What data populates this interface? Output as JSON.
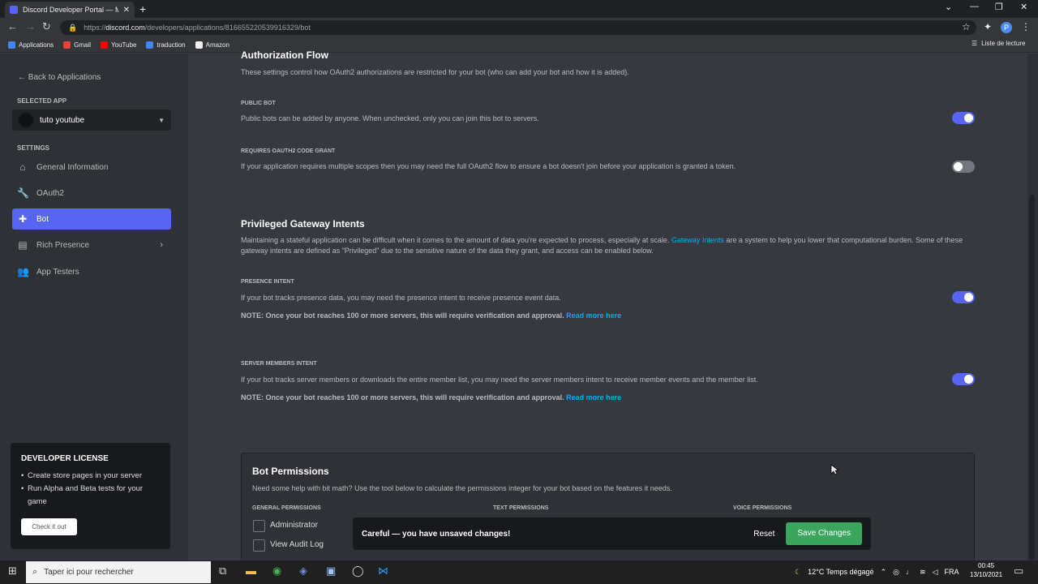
{
  "browser": {
    "tab_title": "Discord Developer Portal — My A",
    "url_prefix": "https://",
    "url_domain": "discord.com",
    "url_path": "/developers/applications/816655220539916329/bot",
    "bookmarks": [
      "Applications",
      "Gmail",
      "YouTube",
      "traduction",
      "Amazon"
    ],
    "reading_list": "Liste de lecture",
    "profile_initial": "P"
  },
  "sidebar": {
    "back": "Back to Applications",
    "selected_app_label": "SELECTED APP",
    "app_name": "tuto youtube",
    "settings_label": "SETTINGS",
    "items": [
      {
        "label": "General Information",
        "icon": "home-icon"
      },
      {
        "label": "OAuth2",
        "icon": "wrench-icon"
      },
      {
        "label": "Bot",
        "icon": "puzzle-icon"
      },
      {
        "label": "Rich Presence",
        "icon": "document-icon"
      },
      {
        "label": "App Testers",
        "icon": "people-icon"
      }
    ],
    "license": {
      "title": "DEVELOPER LICENSE",
      "bullets": [
        "Create store pages in your server",
        "Run Alpha and Beta tests for your game"
      ],
      "button": "Check it out"
    }
  },
  "main": {
    "auth_title": "Authorization Flow",
    "auth_desc": "These settings control how OAuth2 authorizations are restricted for your bot (who can add your bot and how it is added).",
    "public_bot": {
      "label": "PUBLIC BOT",
      "desc": "Public bots can be added by anyone. When unchecked, only you can join this bot to servers.",
      "on": true
    },
    "oauth_grant": {
      "label": "REQUIRES OAUTH2 CODE GRANT",
      "desc": "If your application requires multiple scopes then you may need the full OAuth2 flow to ensure a bot doesn't join before your application is granted a token.",
      "on": false
    },
    "intents_title": "Privileged Gateway Intents",
    "intents_desc_a": "Maintaining a stateful application can be difficult when it comes to the amount of data you're expected to process, especially at scale. ",
    "intents_link": "Gateway Intents",
    "intents_desc_b": " are a system to help you lower that computational burden. Some of these gateway intents are defined as \"Privileged\" due to the sensitive nature of the data they grant, and access can be enabled below.",
    "presence": {
      "label": "PRESENCE INTENT",
      "desc": "If your bot tracks presence data, you may need the presence intent to receive presence event data.",
      "on": true
    },
    "members": {
      "label": "SERVER MEMBERS INTENT",
      "desc": "If your bot tracks server members or downloads the entire member list, you may need the server members intent to receive member events and the member list.",
      "on": true
    },
    "note": "NOTE: Once your bot reaches 100 or more servers, this will require verification and approval. ",
    "read_more": "Read more here",
    "perm_title": "Bot Permissions",
    "perm_desc": "Need some help with bit math? Use the tool below to calculate the permissions integer for your bot based on the features it needs.",
    "perm_cols": [
      "GENERAL PERMISSIONS",
      "TEXT PERMISSIONS",
      "VOICE PERMISSIONS"
    ],
    "general_perms": [
      "Administrator",
      "View Audit Log"
    ]
  },
  "unsaved": {
    "message": "Careful — you have unsaved changes!",
    "reset": "Reset",
    "save": "Save Changes"
  },
  "taskbar": {
    "search_placeholder": "Taper ici pour rechercher",
    "weather": "12°C  Temps dégagé",
    "lang": "FRA",
    "time": "00:45",
    "date": "13/10/2021"
  }
}
